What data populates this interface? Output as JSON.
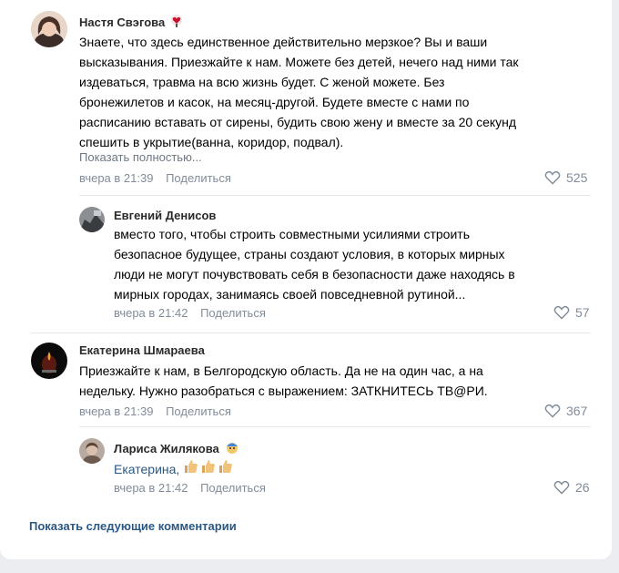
{
  "comments": [
    {
      "author": "Настя Свэгова",
      "lines": [
        "Знаете, что здесь единственное действительно мерзкое? Вы и ваши",
        "высказывания. Приезжайте к нам. Можете без детей, нечего над ними так",
        "издеваться, травма на всю жизнь будет. С женой можете. Без",
        "бронежилетов и касок, на месяц-другой. Будете вместе с нами по",
        "расписанию вставать от сирены, будить свою жену и вместе за 20 секунд",
        "спешить в укрытие(ванна, коридор, подвал)."
      ],
      "show_more": "Показать полностью...",
      "time": "вчера в 21:39",
      "share": "Поделиться",
      "likes": "525"
    },
    {
      "author": "Евгений Денисов",
      "lines": [
        "вместо того, чтобы строить совместными усилиями строить",
        "безопасное будущее, страны создают условия, в которых мирных",
        "люди не могут почувствовать себя в безопасности даже находясь в",
        "мирных городах, занимаясь своей повседневной рутиной..."
      ],
      "time": "вчера в 21:42",
      "share": "Поделиться",
      "likes": "57"
    },
    {
      "author": "Екатерина Шмараева",
      "lines": [
        "Приезжайте к нам, в Белгородскую область. Да не на один час, а на",
        "недельку. Нужно разобраться с выражением: ЗАТКНИТЕСЬ ТВ@РИ."
      ],
      "time": "вчера в 21:39",
      "share": "Поделиться",
      "likes": "367"
    },
    {
      "author": "Лариса Жилякова",
      "reply_to": "Екатерина,",
      "time": "вчера в 21:42",
      "share": "Поделиться",
      "likes": "26"
    }
  ],
  "footer": {
    "show_next": "Показать следующие комментарии"
  },
  "icons": {
    "like": "heart-icon",
    "badge_1": "heart-badge-icon",
    "badge_2": "face-badge-icon",
    "reaction": "thumbs-up-icon"
  },
  "colors": {
    "link": "#2a5885",
    "muted": "#818c99",
    "background": "#ebedf0"
  }
}
